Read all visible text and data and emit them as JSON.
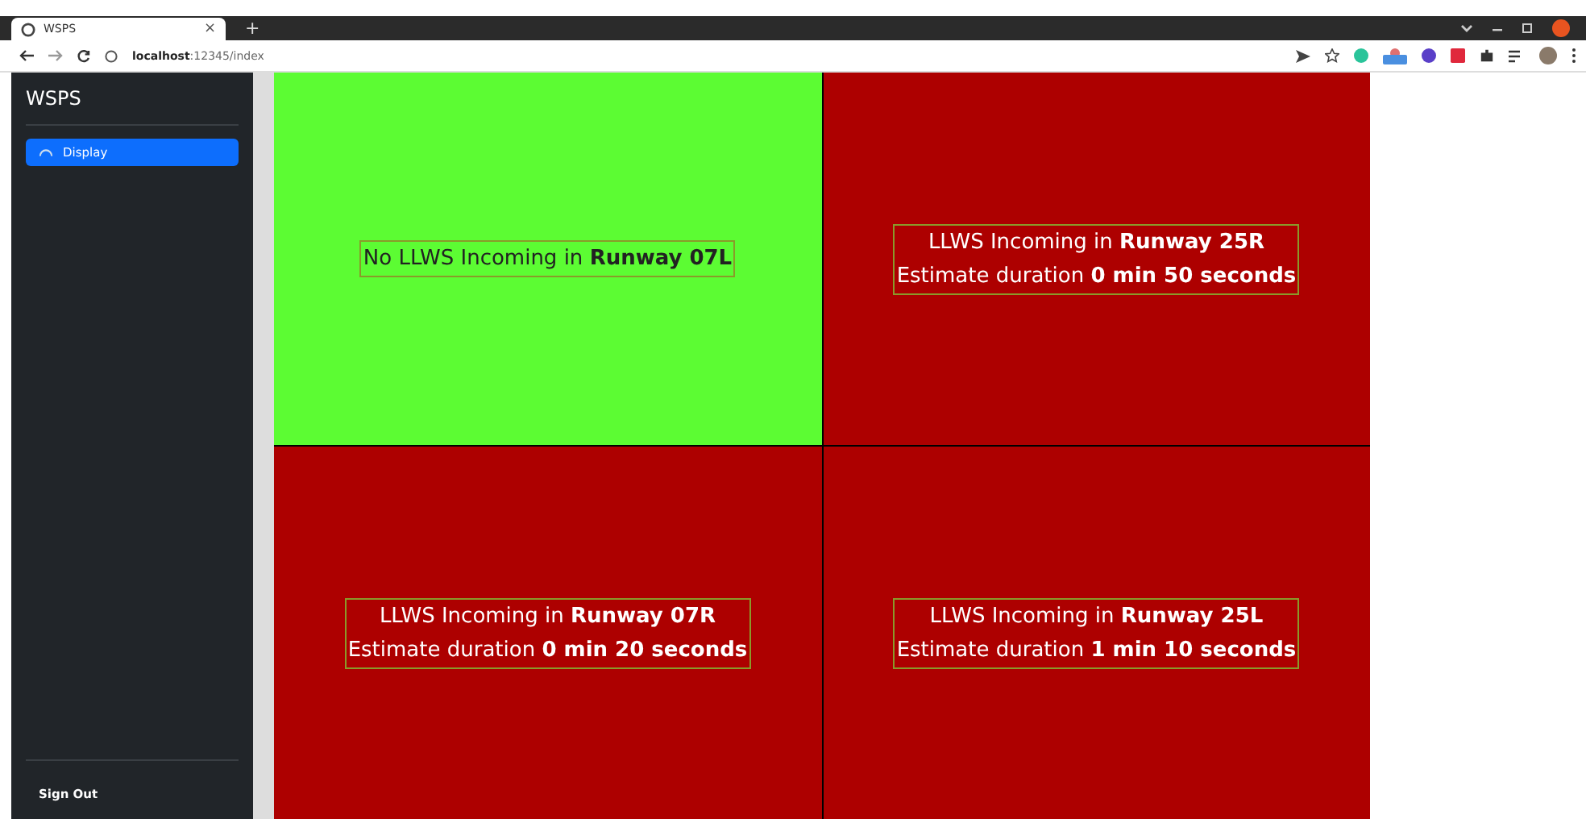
{
  "browser": {
    "tab_title": "WSPS",
    "tab_close": "×",
    "new_tab": "+",
    "url_host": "localhost",
    "url_path": ":12345/index"
  },
  "sidebar": {
    "title": "WSPS",
    "items": [
      {
        "label": "Display",
        "selected": true
      }
    ],
    "footer": "Sign Out"
  },
  "panel_rows": [
    {
      "panels": [
        {
          "alert": false,
          "lines": [
            "No LLWS Incoming in **Runway 07L**"
          ]
        },
        {
          "alert": true,
          "lines": [
            "LLWS Incoming in **Runway 25R**",
            "Estimate duration **0 min 50 seconds**"
          ]
        }
      ]
    },
    {
      "panels": [
        {
          "alert": true,
          "lines": [
            "LLWS Incoming in **Runway 07R**",
            "Estimate duration **0 min 20 seconds**"
          ]
        },
        {
          "alert": true,
          "lines": [
            "LLWS Incoming in **Runway 25L**",
            "Estimate duration **1 min 10 seconds**"
          ]
        }
      ]
    }
  ]
}
